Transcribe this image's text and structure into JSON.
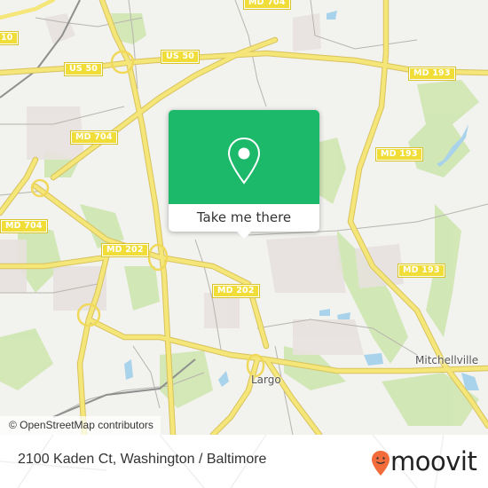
{
  "map": {
    "road_labels": [
      {
        "id": "i-10-partial",
        "text": "10"
      },
      {
        "id": "md-704-top",
        "text": "MD 704"
      },
      {
        "id": "us-50-left",
        "text": "US 50"
      },
      {
        "id": "us-50-right",
        "text": "US 50"
      },
      {
        "id": "md-193-top",
        "text": "MD 193"
      },
      {
        "id": "md-704-center",
        "text": "MD 704"
      },
      {
        "id": "md-193-mid",
        "text": "MD 193"
      },
      {
        "id": "md-704-left",
        "text": "MD 704"
      },
      {
        "id": "md-202-left",
        "text": "MD 202"
      },
      {
        "id": "md-202-center",
        "text": "MD 202"
      },
      {
        "id": "md-193-lower",
        "text": "MD 193"
      }
    ],
    "places": [
      {
        "id": "largo",
        "text": "Largo"
      },
      {
        "id": "mitchellville",
        "text": "Mitchellville"
      }
    ],
    "attribution": "© OpenStreetMap contributors"
  },
  "popup": {
    "icon": "map-pin-icon",
    "action_label": "Take me there",
    "accent_color": "#1db96b"
  },
  "footer": {
    "address": "2100 Kaden Ct, Washington / Baltimore",
    "brand": "moovit",
    "brand_color": "#f26b3a"
  }
}
